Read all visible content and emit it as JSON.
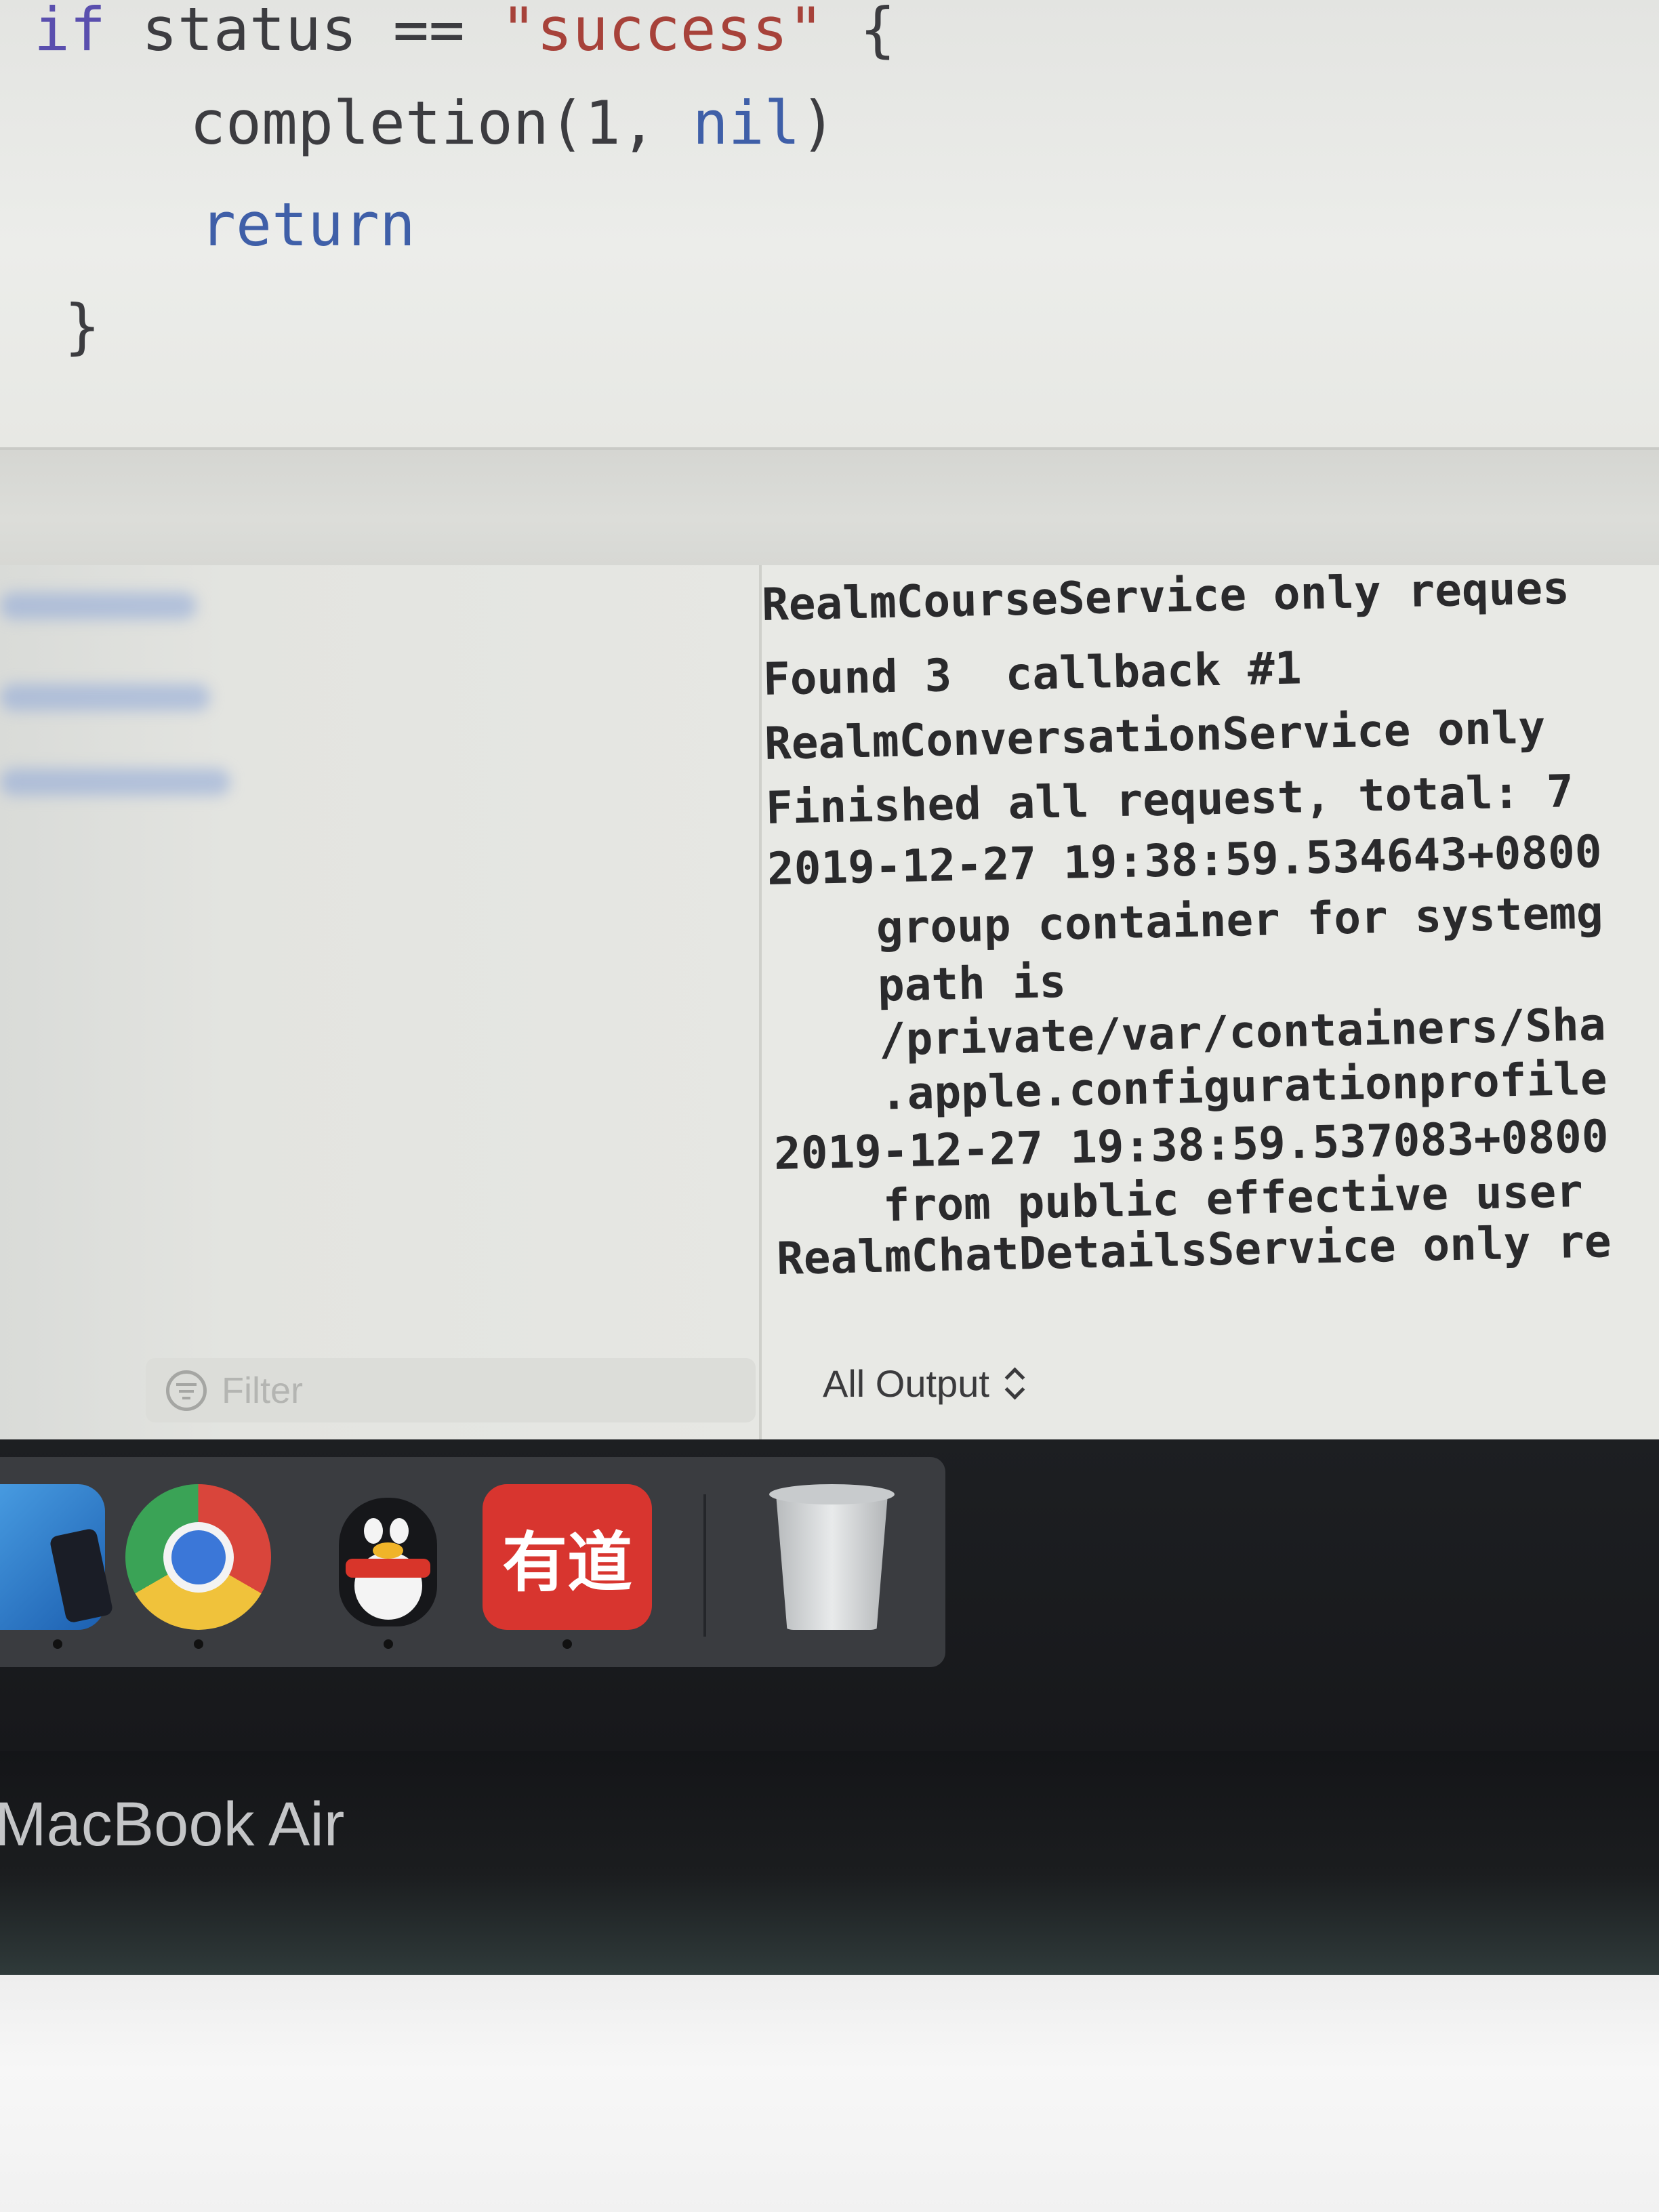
{
  "editor": {
    "line1": {
      "kw": "if",
      "text": " status == ",
      "str": "\"success\"",
      "tail": " {"
    },
    "line2": {
      "text": "completion(1, ",
      "kw": "nil",
      "tail": ")"
    },
    "line3": {
      "kw": "return"
    },
    "line4": {
      "text": "}"
    }
  },
  "variables_filter": {
    "placeholder": "Filter",
    "icon": "filter-icon"
  },
  "console": {
    "lines": [
      "RealmCourseService only reques",
      "Found 3  callback #1",
      "RealmConversationService only ",
      "Finished all request, total: 7",
      "2019-12-27 19:38:59.534643+0800",
      "    group container for systemg",
      "    path is",
      "    /private/var/containers/Sha",
      "    .apple.configurationprofile",
      "2019-12-27 19:38:59.537083+0800",
      "    from public effective user ",
      "RealmChatDetailsService only re"
    ],
    "output_selector": "All Output"
  },
  "dock": {
    "apps": [
      {
        "name": "xcode",
        "icon": "xcode-hammer-icon"
      },
      {
        "name": "chrome",
        "icon": "chrome-icon"
      },
      {
        "name": "qq",
        "icon": "qq-penguin-icon"
      },
      {
        "name": "youdao",
        "icon": "youdao-icon",
        "label": "有道"
      },
      {
        "name": "trash",
        "icon": "trash-icon"
      }
    ]
  },
  "bezel": {
    "label": "MacBook Air"
  },
  "colors": {
    "keyword": "#5a4fae",
    "string": "#a7423a",
    "youdao_red": "#d8352f"
  }
}
